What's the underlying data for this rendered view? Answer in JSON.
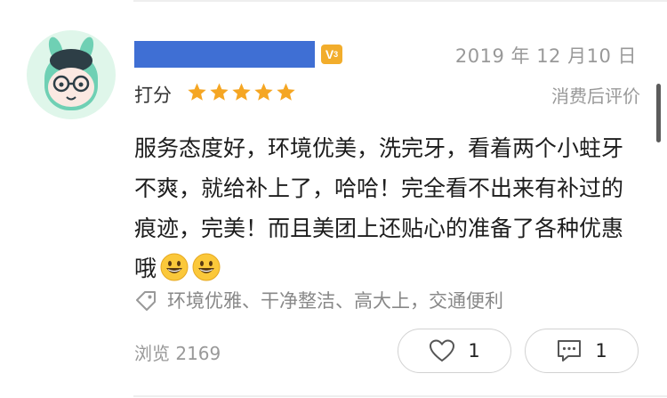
{
  "review": {
    "date": "2019 年 12 月10 日",
    "level_badge": "V",
    "level_num": "3",
    "rating_label": "打分",
    "rating": 5,
    "rating_max": 5,
    "review_type": "消费后评价",
    "text": "服务态度好，环境优美，洗完牙，看着两个小蛀牙不爽，就给补上了，哈哈！完全看不出来有补过的痕迹，完美！而且美团上还贴心的准备了各种优惠哦",
    "emojis": [
      "grinning-face",
      "grinning-face"
    ],
    "tags": "环境优雅、干净整洁、高大上，交通便利",
    "views": "浏览 2169",
    "like_count": "1",
    "comment_count": "1"
  },
  "colors": {
    "star": "#f5a623",
    "username_bar": "#3f6fd4",
    "badge": "#f2ad2c"
  }
}
